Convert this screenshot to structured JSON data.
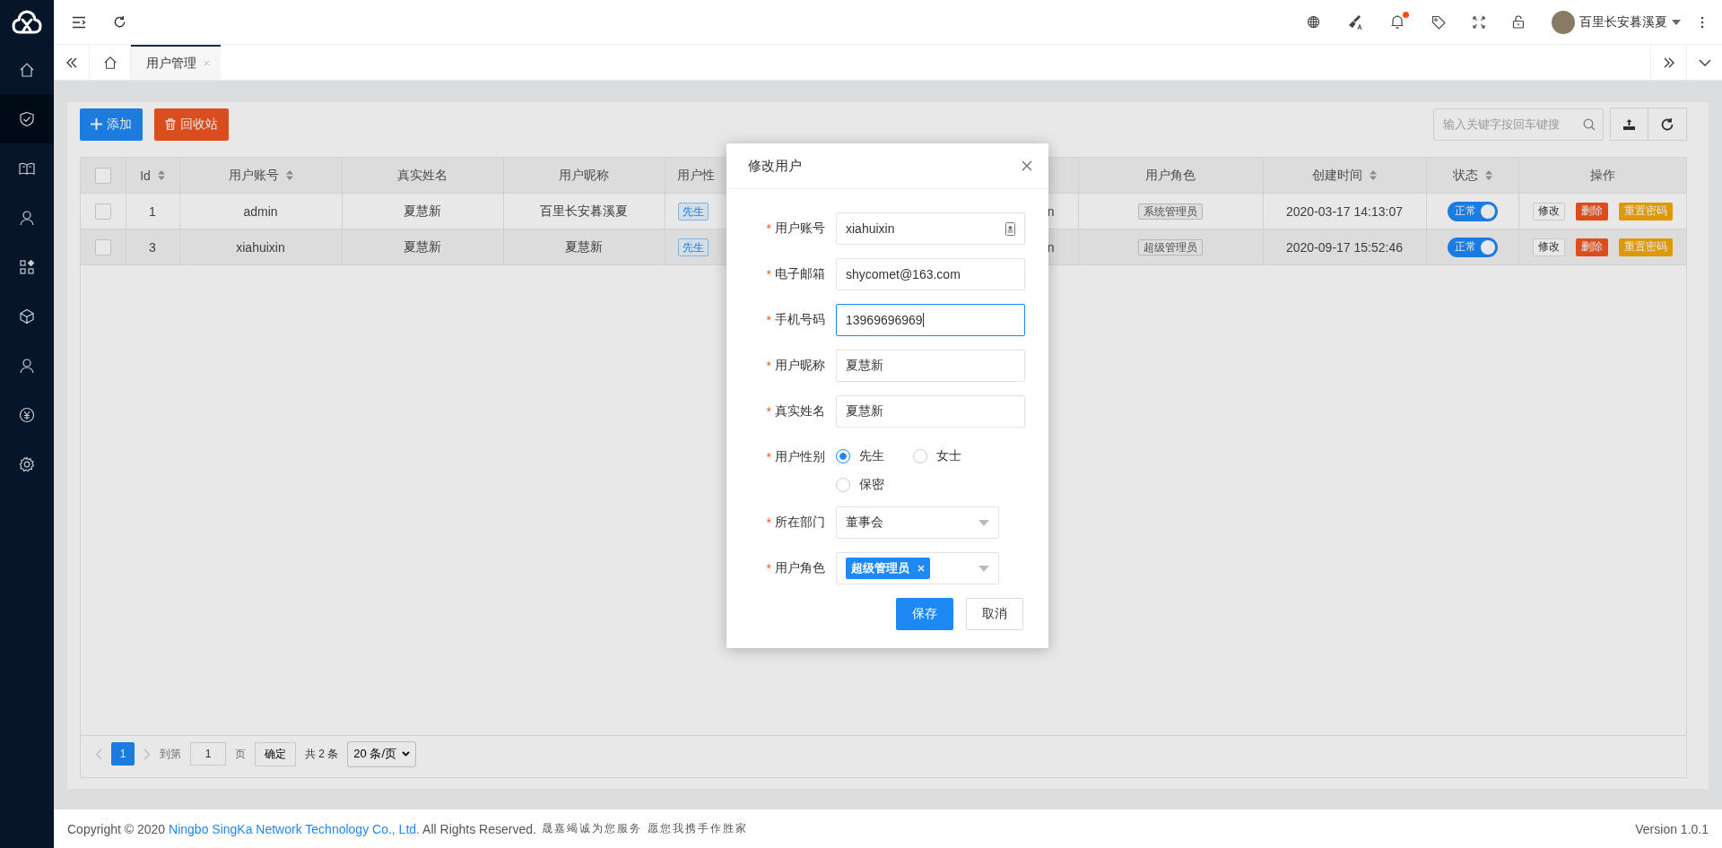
{
  "sidebar": {
    "items": [
      {
        "selected": false
      },
      {
        "selected": true
      },
      {
        "selected": false
      },
      {
        "selected": false
      },
      {
        "selected": false
      },
      {
        "selected": false
      },
      {
        "selected": false
      },
      {
        "selected": false
      },
      {
        "selected": false
      }
    ]
  },
  "header": {
    "notification_unread": true,
    "user": {
      "name": "百里长安暮溪夏"
    }
  },
  "tabs": [
    {
      "label": "用户管理",
      "selected": true
    }
  ],
  "toolbar": {
    "add_button": "添加",
    "recycle_button": "回收站",
    "search": {
      "placeholder": "输入关键字按回车键搜"
    }
  },
  "table": {
    "select_all_checked": false,
    "columns": [
      {
        "kind": "checkbox"
      },
      {
        "kind": "text",
        "label": "Id",
        "sortable": true
      },
      {
        "kind": "text",
        "label": "用户账号",
        "sortable": true
      },
      {
        "kind": "text",
        "label": "真实姓名",
        "sortable": false
      },
      {
        "kind": "text",
        "label": "用户昵称",
        "sortable": false
      },
      {
        "kind": "text",
        "label": "用户性",
        "sortable": false
      },
      {
        "kind": "blank"
      },
      {
        "kind": "text",
        "label": "用户角色",
        "sortable": false
      },
      {
        "kind": "text",
        "label": "创建时间",
        "sortable": true
      },
      {
        "kind": "text",
        "label": "状态",
        "sortable": true
      },
      {
        "kind": "text",
        "label": "操作",
        "sortable": false
      }
    ],
    "rows": [
      {
        "checked": false,
        "hovered": false,
        "id": "1",
        "account": "admin",
        "real_name": "夏慧新",
        "nickname": "百里长安暮溪夏",
        "gender": "先生",
        "column_7": "n",
        "role": "系统管理员",
        "created": "2020-03-17 14:13:07",
        "status": {
          "label": "正常",
          "on": true
        },
        "actions": [
          {
            "label": "修改",
            "kind": "default"
          },
          {
            "label": "删除",
            "kind": "danger"
          },
          {
            "label": "重置密码",
            "kind": "warning"
          }
        ]
      },
      {
        "checked": false,
        "hovered": true,
        "id": "3",
        "account": "xiahuixin",
        "real_name": "夏慧新",
        "nickname": "夏慧新",
        "gender": "先生",
        "column_7": "n",
        "role": "超级管理员",
        "created": "2020-09-17 15:52:46",
        "status": {
          "label": "正常",
          "on": true
        },
        "actions": [
          {
            "label": "修改",
            "kind": "default"
          },
          {
            "label": "删除",
            "kind": "danger"
          },
          {
            "label": "重置密码",
            "kind": "warning"
          }
        ]
      }
    ]
  },
  "pagination": {
    "pages": [
      {
        "label": "1",
        "selected": true
      }
    ],
    "goto_label": "到第",
    "goto_value": "1",
    "page_unit": "页",
    "confirm": "确定",
    "total": "共 2 条",
    "page_size": "20 条/页"
  },
  "footer": {
    "copyright": "Copyright © 2020",
    "company_link": "Ningbo SingKa Network Technology Co., Ltd.",
    "rights": "All Rights Reserved.",
    "slogan": "晟嘉竭诚为您服务 愿您我携手作胜家",
    "version": "Version 1.0.1"
  },
  "dialog": {
    "title": "修改用户",
    "fields": [
      {
        "kind": "text",
        "required_mark": "*",
        "label": "用户账号",
        "value": "xiahuixin",
        "focused": false,
        "autofill_icon": true
      },
      {
        "kind": "text",
        "required_mark": "*",
        "label": "电子邮箱",
        "value": "shycomet@163.com",
        "focused": false,
        "autofill_icon": false
      },
      {
        "kind": "text",
        "required_mark": "*",
        "label": "手机号码",
        "value": "13969696969",
        "focused": true,
        "autofill_icon": false
      },
      {
        "kind": "text",
        "required_mark": "*",
        "label": "用户昵称",
        "value": "夏慧新",
        "focused": false,
        "autofill_icon": false
      },
      {
        "kind": "text",
        "required_mark": "*",
        "label": "真实姓名",
        "value": "夏慧新",
        "focused": false,
        "autofill_icon": false
      },
      {
        "kind": "radio",
        "required_mark": "*",
        "label": "用户性别",
        "options": [
          {
            "label": "先生",
            "selected": true
          },
          {
            "label": "女士",
            "selected": false
          },
          {
            "label": "保密",
            "selected": false
          }
        ]
      },
      {
        "kind": "select",
        "required_mark": "*",
        "label": "所在部门",
        "value": "董事会"
      },
      {
        "kind": "tags",
        "required_mark": "*",
        "label": "用户角色",
        "tags": [
          "超级管理员"
        ]
      }
    ],
    "buttons": [
      {
        "label": "保存",
        "kind": "primary"
      },
      {
        "label": "取消",
        "kind": "default"
      }
    ]
  }
}
